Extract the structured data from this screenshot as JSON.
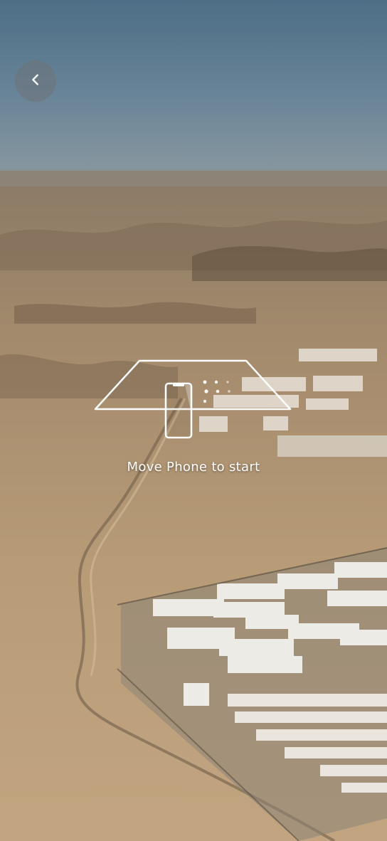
{
  "header": {
    "back_icon": "chevron-left-icon"
  },
  "ar_guide": {
    "plane_icon": "ar-plane-outline-icon",
    "phone_icon": "phone-outline-icon",
    "instruction": "Move Phone to start"
  },
  "colors": {
    "overlay_text": "#ffffff",
    "button_bg": "rgba(110,115,120,0.55)"
  }
}
